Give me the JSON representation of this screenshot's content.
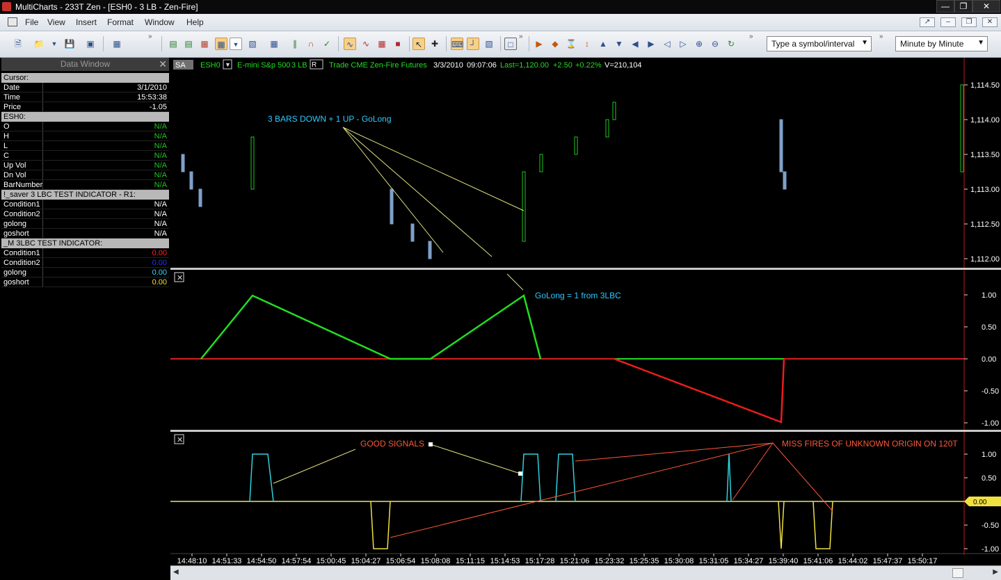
{
  "window": {
    "title": "MultiCharts - 233T Zen - [ESH0 - 3 LB - Zen-Fire]"
  },
  "menu": [
    "File",
    "View",
    "Insert",
    "Format",
    "Window",
    "Help"
  ],
  "toolbar": {
    "symbol_placeholder": "Type a symbol/interval",
    "interval": "Minute by Minute"
  },
  "data_window": {
    "title": "Data Window",
    "rows": [
      {
        "type": "header",
        "label": "Cursor:"
      },
      {
        "label": "Date",
        "value": "3/1/2010",
        "color": "#ffffff"
      },
      {
        "label": "Time",
        "value": "15:53:38",
        "color": "#ffffff"
      },
      {
        "label": "Price",
        "value": "-1.05",
        "color": "#ffffff"
      },
      {
        "type": "header",
        "label": "ESH0:"
      },
      {
        "label": "O",
        "value": "N/A",
        "color": "#22c322"
      },
      {
        "label": "H",
        "value": "N/A",
        "color": "#22c322"
      },
      {
        "label": "L",
        "value": "N/A",
        "color": "#22c322"
      },
      {
        "label": "C",
        "value": "N/A",
        "color": "#22c322"
      },
      {
        "label": "Up Vol",
        "value": "N/A",
        "color": "#22c322"
      },
      {
        "label": "Dn Vol",
        "value": "N/A",
        "color": "#22c322"
      },
      {
        "label": "BarNumber",
        "value": "N/A",
        "color": "#22c322"
      },
      {
        "type": "header",
        "label": "!_saver 3 LBC TEST INDICATOR - R1:"
      },
      {
        "label": "Condition1",
        "value": "N/A",
        "color": "#ffffff"
      },
      {
        "label": "Condition2",
        "value": "N/A",
        "color": "#ffffff"
      },
      {
        "label": "golong",
        "value": "N/A",
        "color": "#ffffff"
      },
      {
        "label": "goshort",
        "value": "N/A",
        "color": "#ffffff"
      },
      {
        "type": "header",
        "label": "_M 3LBC TEST INDICATOR:"
      },
      {
        "label": "Condition1",
        "value": "0.00",
        "color": "#ff2020"
      },
      {
        "label": "Condition2",
        "value": "0.00",
        "color": "#2a2aff"
      },
      {
        "label": "golong",
        "value": "0.00",
        "color": "#30d8ff"
      },
      {
        "label": "goshort",
        "value": "0.00",
        "color": "#f0e030"
      }
    ]
  },
  "chart": {
    "status": {
      "sa": "SA",
      "symbol": "ESH0",
      "desc": "E-mini S&p 500",
      "bars": "3 LB",
      "r": "R",
      "info": "Trade  CME  Zen-Fire  Futures",
      "date": "3/3/2010",
      "time": "09:07:06",
      "last": "Last=1,120.00",
      "chg": "+2.50",
      "pct": "+0.22%",
      "vol": "V=210,104"
    },
    "annotations": {
      "a1": "3 BARS DOWN + 1 UP - GoLong",
      "a2": "GoLong = 1 from 3LBC",
      "a3": "GOOD SIGNALS",
      "a4": "MISS FIRES OF UNKNOWN ORIGIN ON 120T"
    },
    "price_axis": [
      "1,114.50",
      "1,114.00",
      "1,113.50",
      "1,113.00",
      "1,112.50",
      "1,112.00"
    ],
    "panel2_axis": [
      "1.00",
      "0.50",
      "0.00",
      "-0.50",
      "-1.00"
    ],
    "panel3_axis": [
      "1.00",
      "0.50",
      "0.00",
      "-0.50",
      "-1.00"
    ],
    "panel3_last": "0.00",
    "time_axis": [
      "14:48:10",
      "14:51:33",
      "14:54:50",
      "14:57:54",
      "15:00:45",
      "15:04:27",
      "15:06:54",
      "15:08:08",
      "15:11:15",
      "15:14:53",
      "15:17:28",
      "15:21:06",
      "15:23:32",
      "15:25:35",
      "15:30:08",
      "15:31:05",
      "15:34:27",
      "15:39:40",
      "15:41:06",
      "15:44:02",
      "15:47:37",
      "15:50:17"
    ]
  },
  "chart_data": [
    {
      "type": "line_break",
      "title": "ESH0 - 3 LB",
      "colors": {
        "up": "#1ec81e",
        "down": "#7fa0c8"
      },
      "bars": [
        {
          "dir": "down",
          "top": 1113.5,
          "bottom": 1113.25
        },
        {
          "dir": "down",
          "top": 1113.25,
          "bottom": 1113.0
        },
        {
          "dir": "down",
          "top": 1113.0,
          "bottom": 1112.75
        },
        {
          "dir": "up",
          "top": 1113.75,
          "bottom": 1113.0
        },
        {
          "dir": "down",
          "top": 1113.0,
          "bottom": 1112.5
        },
        {
          "dir": "down",
          "top": 1112.5,
          "bottom": 1112.25
        },
        {
          "dir": "down",
          "top": 1112.25,
          "bottom": 1112.0
        },
        {
          "dir": "up",
          "top": 1113.25,
          "bottom": 1112.25
        },
        {
          "dir": "up",
          "top": 1113.5,
          "bottom": 1113.25
        },
        {
          "dir": "up",
          "top": 1113.75,
          "bottom": 1113.5
        },
        {
          "dir": "up",
          "top": 1114.0,
          "bottom": 1113.75
        },
        {
          "dir": "up",
          "top": 1114.25,
          "bottom": 1114.0
        },
        {
          "dir": "down",
          "top": 1114.0,
          "bottom": 1113.25
        },
        {
          "dir": "down",
          "top": 1113.25,
          "bottom": 1113.0
        },
        {
          "dir": "up",
          "top": 1114.5,
          "bottom": 1113.25
        }
      ],
      "ylim": [
        1112.0,
        1114.5
      ]
    },
    {
      "type": "line",
      "series": [
        {
          "name": "golong",
          "color": "#22dd22",
          "values": [
            0,
            1,
            0,
            0,
            1,
            0,
            0,
            0,
            0
          ]
        },
        {
          "name": "goshort",
          "color": "#ee1c1c",
          "values": [
            0,
            0,
            0,
            0,
            0,
            0,
            -1,
            0,
            0
          ]
        }
      ],
      "ylim": [
        -1,
        1
      ]
    },
    {
      "type": "line",
      "series": [
        {
          "name": "golong",
          "color": "#30d0e0",
          "values": [
            0,
            1,
            0,
            0,
            1,
            1,
            0,
            1,
            0,
            0
          ]
        },
        {
          "name": "goshort",
          "color": "#f0e040",
          "values": [
            0,
            0,
            -1,
            0,
            0,
            0,
            0,
            0,
            -1,
            -1
          ]
        }
      ],
      "ylim": [
        -1,
        1
      ]
    }
  ]
}
